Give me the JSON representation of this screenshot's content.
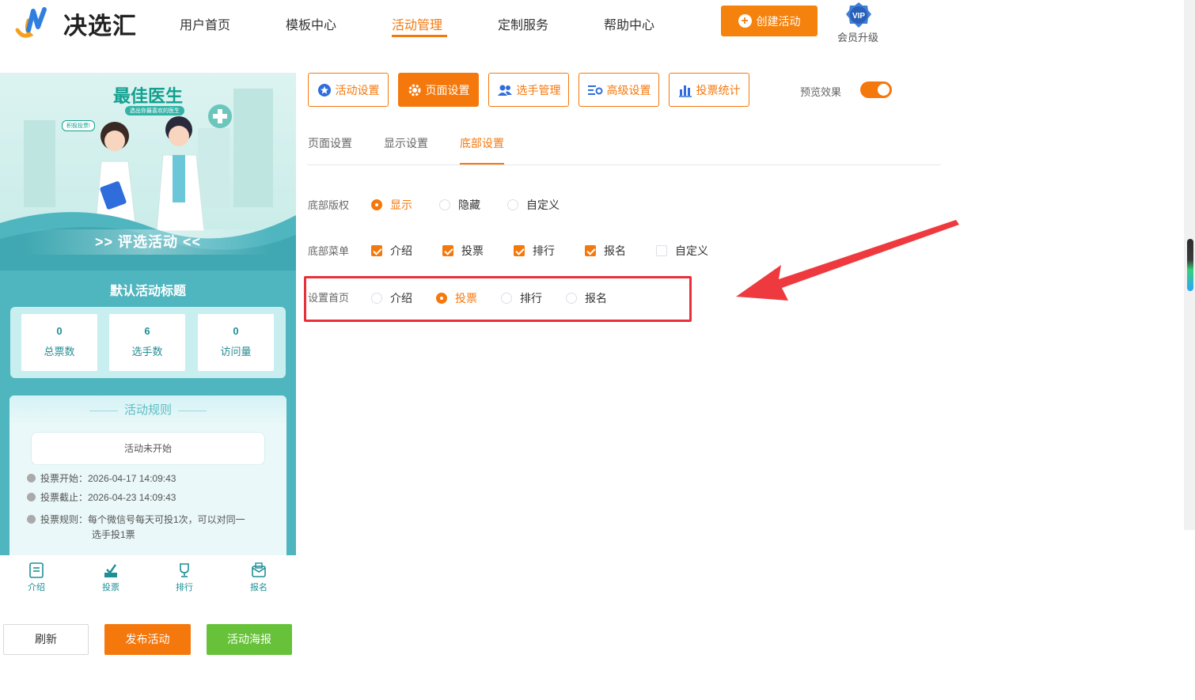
{
  "header": {
    "logo_text": "决选汇",
    "nav": [
      "用户首页",
      "模板中心",
      "活动管理",
      "定制服务",
      "帮助中心"
    ],
    "active_nav": "活动管理",
    "create_button": "创建活动",
    "vip_badge": "VIP",
    "vip_label": "会员升级"
  },
  "preview": {
    "banner_title": "最佳医生",
    "banner_subtitle": "选出你最喜欢的医生",
    "banner_bubble": "积极投票!",
    "banner_strip": ">> 评选活动 <<",
    "activity_title": "默认活动标题",
    "stats": [
      {
        "value": "0",
        "label": "总票数"
      },
      {
        "value": "6",
        "label": "选手数"
      },
      {
        "value": "0",
        "label": "访问量"
      }
    ],
    "rules_title": "活动规则",
    "status": "活动未开始",
    "vote_start": "投票开始：2026-04-17 14:09:43",
    "vote_end": "投票截止：2026-04-23 14:09:43",
    "vote_rule_1": "投票规则：每个微信号每天可投1次，可以对同一",
    "vote_rule_2": "选手投1票",
    "tabs": [
      "介绍",
      "投票",
      "排行",
      "报名"
    ]
  },
  "actions": {
    "refresh": "刷新",
    "publish": "发布活动",
    "poster": "活动海报"
  },
  "toolbar": {
    "buttons": [
      "活动设置",
      "页面设置",
      "选手管理",
      "高级设置",
      "投票统计"
    ],
    "active": "页面设置",
    "preview_label": "预览效果",
    "preview_on": true
  },
  "subtabs": {
    "items": [
      "页面设置",
      "显示设置",
      "底部设置"
    ],
    "active": "底部设置"
  },
  "settings": {
    "copyright": {
      "label": "底部版权",
      "options": [
        "显示",
        "隐藏",
        "自定义"
      ],
      "selected": "显示"
    },
    "menu": {
      "label": "底部菜单",
      "options": [
        "介绍",
        "投票",
        "排行",
        "报名",
        "自定义"
      ],
      "checked": [
        "介绍",
        "投票",
        "排行",
        "报名"
      ]
    },
    "home": {
      "label": "设置首页",
      "options": [
        "介绍",
        "投票",
        "排行",
        "报名"
      ],
      "selected": "投票"
    }
  },
  "colors": {
    "accent": "#f5780d",
    "teal": "#4fb5bf",
    "green": "#67c23a",
    "annotation": "#e8303a"
  }
}
